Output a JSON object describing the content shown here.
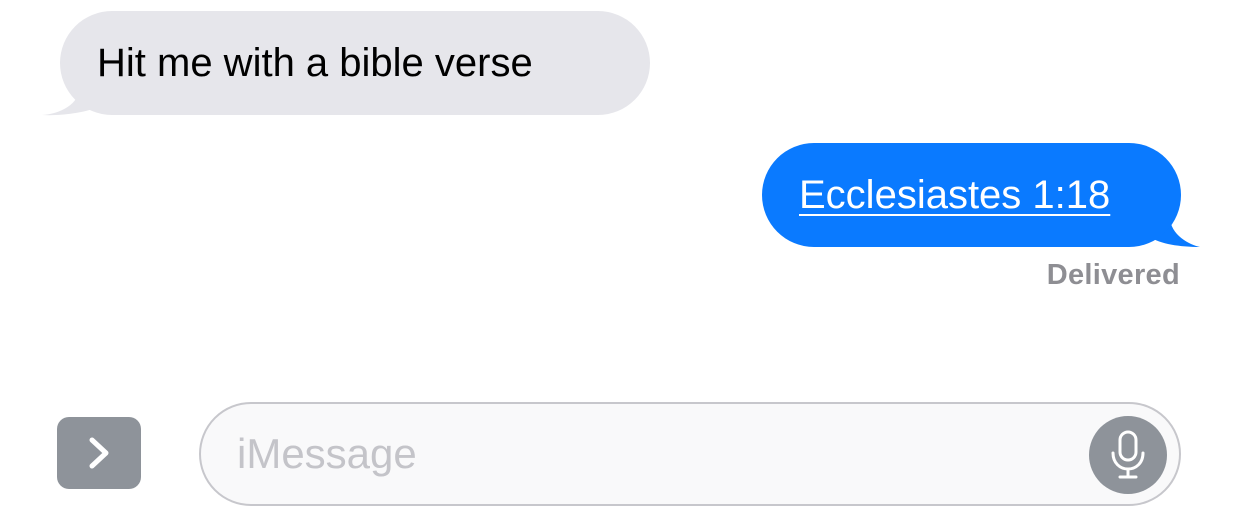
{
  "messages": [
    {
      "direction": "received",
      "text": "Hit me with a bible verse"
    },
    {
      "direction": "sent",
      "text": "Ecclesiastes 1:18",
      "is_link": true,
      "status": "Delivered"
    }
  ],
  "composer": {
    "placeholder": "iMessage",
    "value": "",
    "apps_icon": "chevron-right-icon",
    "mic_icon": "microphone-icon"
  },
  "colors": {
    "received_bubble": "#e6e6eb",
    "sent_bubble": "#0a7aff",
    "status_text": "#8e8e93",
    "button_gray": "#8e939a"
  }
}
